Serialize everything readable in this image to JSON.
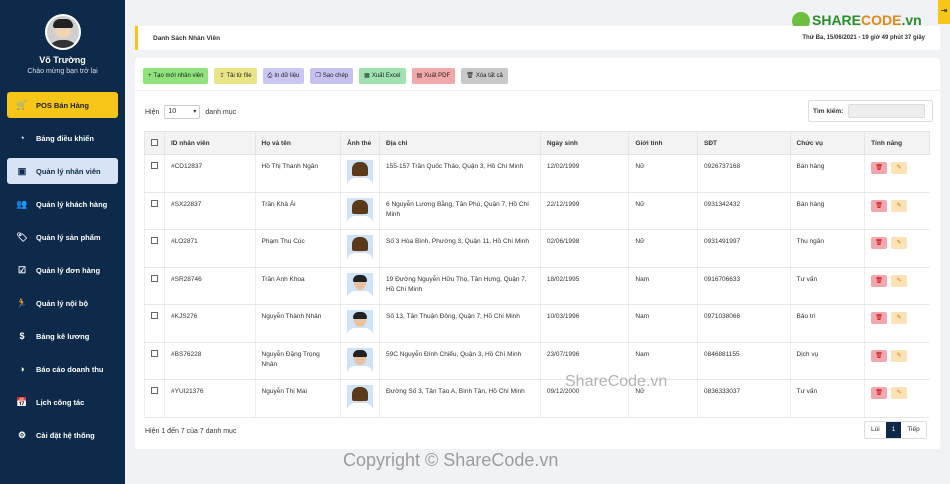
{
  "profile": {
    "name": "Võ Trường",
    "welcome": "Chào mừng bạn trở lại"
  },
  "menu": [
    {
      "label": "POS Bán Hàng",
      "icon": "cart-icon",
      "glyph": "🛒"
    },
    {
      "label": "Bảng điều khiển",
      "icon": "dashboard-icon",
      "glyph": "◔"
    },
    {
      "label": "Quản lý nhân viên",
      "icon": "id-card-icon",
      "glyph": "▣"
    },
    {
      "label": "Quản lý khách hàng",
      "icon": "users-icon",
      "glyph": "👥"
    },
    {
      "label": "Quản lý sản phẩm",
      "icon": "tag-icon",
      "glyph": "🏷"
    },
    {
      "label": "Quản lý đơn hàng",
      "icon": "calendar-check-icon",
      "glyph": "☑"
    },
    {
      "label": "Quản lý nội bộ",
      "icon": "running-icon",
      "glyph": "🏃"
    },
    {
      "label": "Bảng kê lương",
      "icon": "dollar-icon",
      "glyph": "$"
    },
    {
      "label": "Báo cáo doanh thu",
      "icon": "pie-chart-icon",
      "glyph": "◑"
    },
    {
      "label": "Lịch công tác",
      "icon": "calendar-icon",
      "glyph": "📅"
    },
    {
      "label": "Cài đặt hệ thống",
      "icon": "gear-icon",
      "glyph": "⚙"
    }
  ],
  "topbar": {
    "title": "Danh Sách Nhân Viên",
    "datetime": "Thứ Ba, 15/06/2021 - 19 giờ 49 phút 37 giây"
  },
  "logo": {
    "share": "SHARE",
    "code": "CODE",
    "suffix": ".vn"
  },
  "toolbar": [
    {
      "label": "Tạo mới nhân viên",
      "glyph": "+",
      "icon": "plus-icon"
    },
    {
      "label": "Tải từ file",
      "glyph": "⇪",
      "icon": "upload-icon"
    },
    {
      "label": "In dữ liệu",
      "glyph": "⎙",
      "icon": "print-icon"
    },
    {
      "label": "Sao chép",
      "glyph": "❐",
      "icon": "copy-icon"
    },
    {
      "label": "Xuất Excel",
      "glyph": "▦",
      "icon": "excel-icon"
    },
    {
      "label": "Xuất PDF",
      "glyph": "▤",
      "icon": "pdf-icon"
    },
    {
      "label": "Xóa tất cả",
      "glyph": "🗑",
      "icon": "trash-icon"
    }
  ],
  "length": {
    "prefix": "Hiện",
    "value": "10",
    "suffix": "danh mục"
  },
  "search": {
    "label": "Tìm kiếm:"
  },
  "columns": [
    "ID nhân viên",
    "Họ và tên",
    "Ảnh thẻ",
    "Địa chỉ",
    "Ngày sinh",
    "Giới tính",
    "SĐT",
    "Chức vụ",
    "Tính năng"
  ],
  "rows": [
    {
      "id": "#CD12837",
      "name": "Hồ Thị Thanh Ngân",
      "address": "155-157 Trần Quốc Thảo, Quận 3, Hồ Chí Minh",
      "dob": "12/02/1999",
      "gender": "Nữ",
      "phone": "0926737168",
      "role": "Bán hàng"
    },
    {
      "id": "#SX22837",
      "name": "Trần Khả Ái",
      "address": "6 Nguyễn Lương Bằng, Tân Phú, Quận 7, Hồ Chí Minh",
      "dob": "22/12/1999",
      "gender": "Nữ",
      "phone": "0931342432",
      "role": "Bán hàng"
    },
    {
      "id": "#LO2871",
      "name": "Phạm Thu Cúc",
      "address": "Số 3 Hòa Bình, Phường 3, Quận 11, Hồ Chí Minh",
      "dob": "02/06/1998",
      "gender": "Nữ",
      "phone": "0931491997",
      "role": "Thu ngân"
    },
    {
      "id": "#SR28746",
      "name": "Trần Anh Khoa",
      "address": "19 Đường Nguyễn Hữu Thọ, Tân Hưng, Quận 7, Hồ Chí Minh",
      "dob": "18/02/1995",
      "gender": "Nam",
      "phone": "0916706633",
      "role": "Tư vấn"
    },
    {
      "id": "#KJS276",
      "name": "Nguyễn Thành Nhân",
      "address": "Số 13, Tân Thuận Đông, Quận 7, Hồ Chí Minh",
      "dob": "10/03/1996",
      "gender": "Nam",
      "phone": "0971038066",
      "role": "Bảo trì"
    },
    {
      "id": "#BS76228",
      "name": "Nguyễn Đặng Trọng Nhân",
      "address": "59C Nguyễn Đình Chiểu, Quận 3, Hồ Chí Minh",
      "dob": "23/07/1996",
      "gender": "Nam",
      "phone": "0846881155",
      "role": "Dịch vụ"
    },
    {
      "id": "#YUI21376",
      "name": "Nguyễn Thị Mai",
      "address": "Đường Số 3, Tân Tạo A, Bình Tân, Hồ Chí Minh",
      "dob": "09/12/2000",
      "gender": "Nữ",
      "phone": "0836333037",
      "role": "Tư vấn"
    }
  ],
  "footer": {
    "info": "Hiện 1 đến 7 của 7 danh mục"
  },
  "pager": {
    "prev": "Lùi",
    "current": "1",
    "next": "Tiếp"
  },
  "watermarks": {
    "inline": "ShareCode.vn",
    "copyright": "Copyright © ShareCode.vn"
  }
}
